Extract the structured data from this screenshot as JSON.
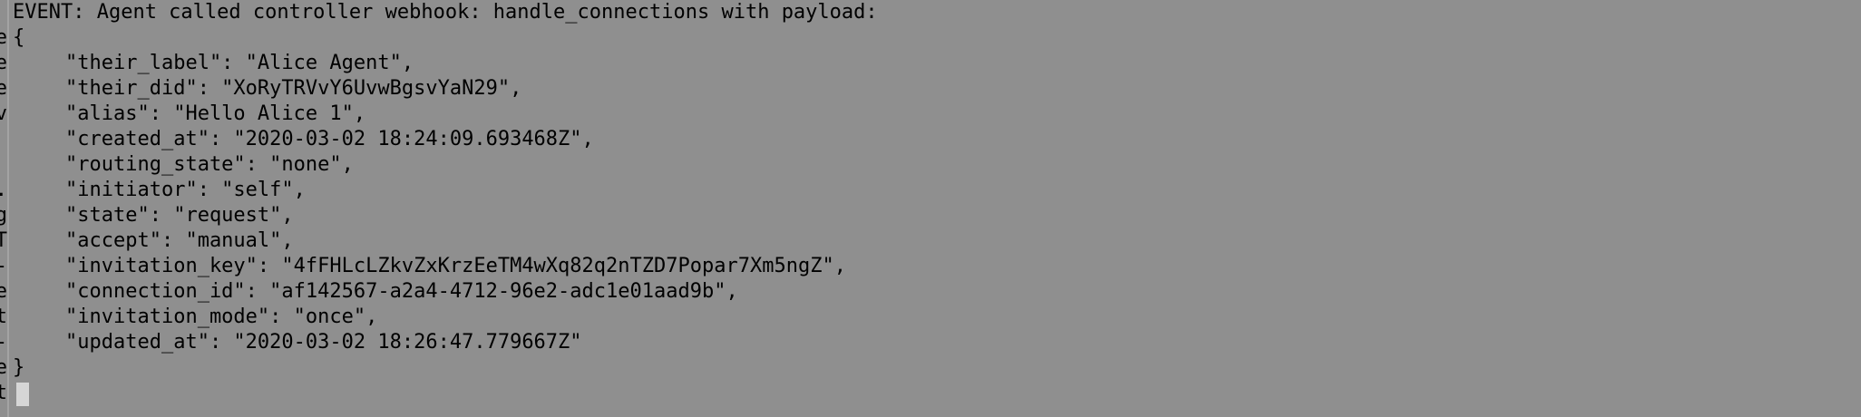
{
  "left_pane": {
    "fragment_text": "\ne\ne\ne\nv\n\n\n.\ng\nT\n-\ne\nt\n-\ne\nt"
  },
  "terminal": {
    "event_line": "EVENT: Agent called controller webhook: handle_connections with payload:",
    "open_brace": "{",
    "payload_lines": [
      "\"their_label\": \"Alice Agent\",",
      "\"their_did\": \"XoRyTRVvY6UvwBgsvYaN29\",",
      "\"alias\": \"Hello Alice 1\",",
      "\"created_at\": \"2020-03-02 18:24:09.693468Z\",",
      "\"routing_state\": \"none\",",
      "\"initiator\": \"self\",",
      "\"state\": \"request\",",
      "\"accept\": \"manual\",",
      "\"invitation_key\": \"4fFHLcLZkvZxKrzEeTM4wXq82q2nTZD7Popar7Xm5ngZ\",",
      "\"connection_id\": \"af142567-a2a4-4712-96e2-adc1e01aad9b\",",
      "\"invitation_mode\": \"once\",",
      "\"updated_at\": \"2020-03-02 18:26:47.779667Z\""
    ],
    "close_brace": "}"
  },
  "colors": {
    "background": "#8f8f8f",
    "text": "#000000",
    "cursor": "#d6d6d6",
    "divider": "#a3a3a3"
  }
}
